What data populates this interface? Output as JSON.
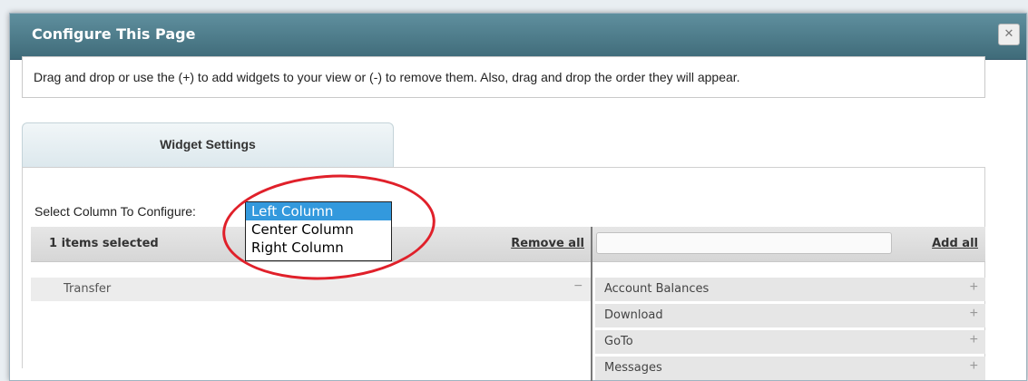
{
  "dialog": {
    "title": "Configure This Page",
    "close_glyph": "✕"
  },
  "instructions": "Drag and drop or use the (+) to add widgets to your view or (-) to remove them. Also, drag and drop the order they will appear.",
  "tab": {
    "label": "Widget Settings"
  },
  "column_select": {
    "label": "Select Column To Configure:",
    "options": [
      "Left Column",
      "Center Column",
      "Right Column"
    ],
    "selected": "Left Column"
  },
  "selected_list": {
    "count_label": "1 items selected",
    "remove_all": "Remove all",
    "items": [
      {
        "label": "Transfer",
        "action": "−"
      }
    ]
  },
  "available_list": {
    "search_value": "",
    "add_all": "Add all",
    "items": [
      {
        "label": "Account Balances",
        "action": "+"
      },
      {
        "label": "Download",
        "action": "+"
      },
      {
        "label": "GoTo",
        "action": "+"
      },
      {
        "label": "Messages",
        "action": "+"
      }
    ]
  },
  "colors": {
    "titlebar": "#4d7d8b",
    "selected_option": "#3399dd",
    "annotation": "#e0202a"
  }
}
